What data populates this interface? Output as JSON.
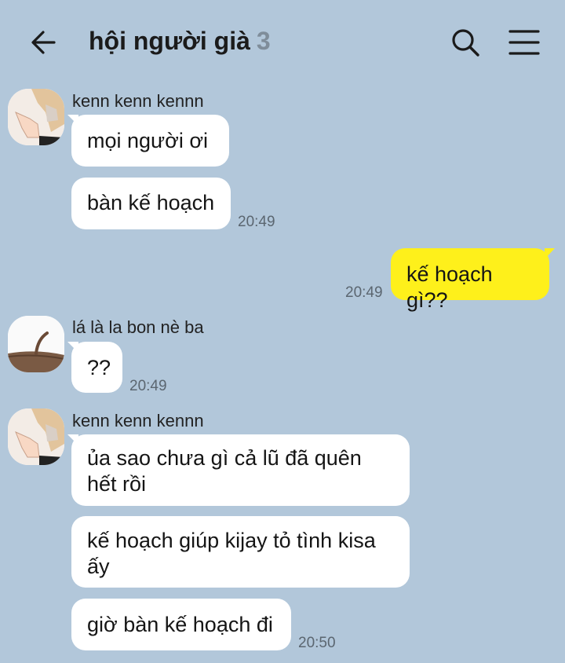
{
  "header": {
    "title": "hội người già",
    "member_count": "3"
  },
  "messages": {
    "g1": {
      "sender": "kenn kenn kennn",
      "b1": "mọi người ơi",
      "b2": "bàn kế hoạch",
      "time": "20:49"
    },
    "me1": {
      "text": "kế hoạch gì??",
      "time": "20:49"
    },
    "g2": {
      "sender": "lá là la bon nè ba",
      "b1": "??",
      "time": "20:49"
    },
    "g3": {
      "sender": "kenn kenn kennn",
      "b1_l1": "ủa sao chưa gì cả lũ đã quên",
      "b1_l2": "hết rồi",
      "b2_l1": "kế hoạch giúp kijay tỏ tình kisa",
      "b2_l2": "ấy",
      "b3": "giờ bàn kế hoạch đi",
      "time": "20:50"
    }
  },
  "colors": {
    "background": "#b2c7da",
    "my_bubble": "#fef01b",
    "other_bubble": "#ffffff"
  }
}
